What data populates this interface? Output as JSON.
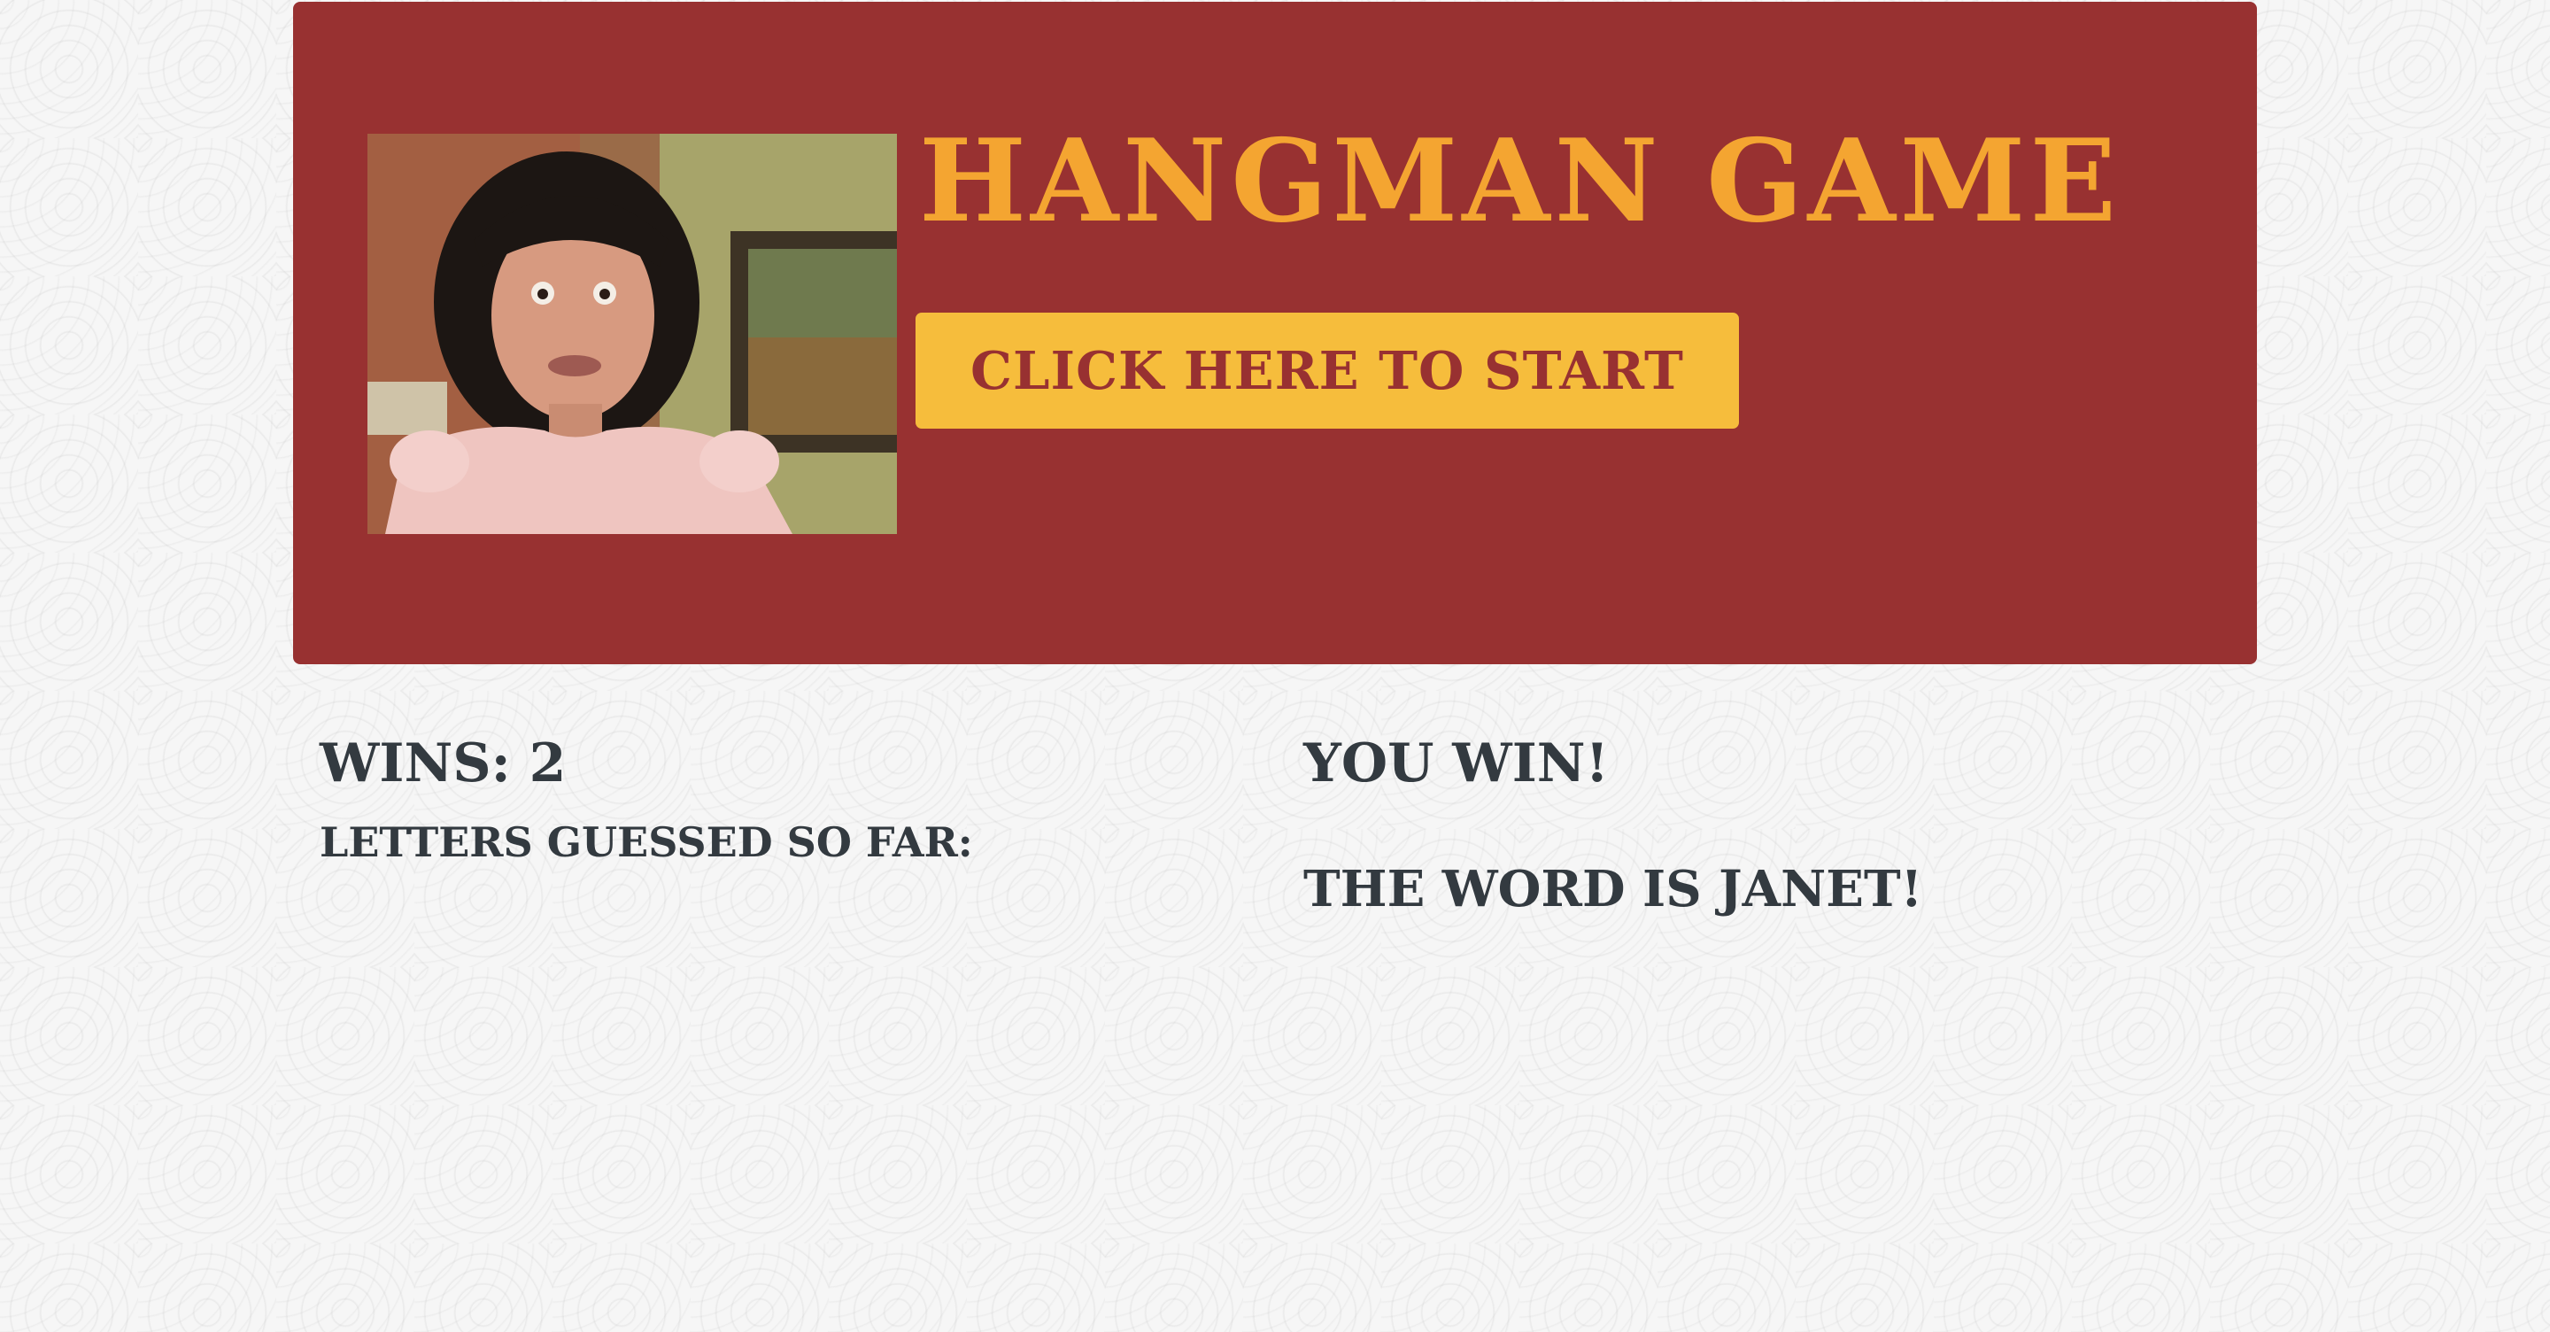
{
  "header": {
    "title": "HANGMAN GAME",
    "start_button_label": "CLICK HERE TO START"
  },
  "stats": {
    "wins": "WINS: 2",
    "letters_guessed_label": "LETTERS GUESSED SO FAR:"
  },
  "result": {
    "message": "YOU WIN!",
    "word_reveal": "THE WORD IS JANET!"
  },
  "colors": {
    "banner_background": "#983131",
    "title_text": "#f4a531",
    "button_background": "#f6bd3c",
    "button_text": "#983131",
    "body_text": "#333a40"
  }
}
